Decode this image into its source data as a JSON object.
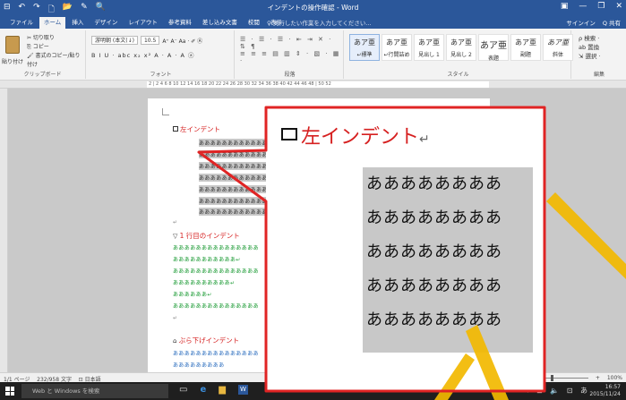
{
  "titlebar": {
    "title": "インデントの操作確認 - Word",
    "qat": [
      "⊟",
      "↶",
      "↷",
      "🗋",
      "📂",
      "✎",
      "🔍"
    ],
    "controls": [
      "▣",
      "—",
      "❐",
      "✕"
    ]
  },
  "ribbon_tabs": {
    "tabs": [
      "ファイル",
      "ホーム",
      "挿入",
      "デザイン",
      "レイアウト",
      "参考資料",
      "差し込み文書",
      "校閲",
      "表示"
    ],
    "tellme": "♀ 実行したい作業を入力してください...",
    "signin": "サインイン",
    "share": "Q 共有"
  },
  "ribbon": {
    "clipboard": {
      "paste": "貼り付け",
      "cut": "✂ 切り取り",
      "copy": "⎘ コピー",
      "format": "🖌 書式のコピー/貼り付け",
      "label": "クリップボード"
    },
    "font": {
      "name": "游明朝 (本文(↓)",
      "size": "10.5",
      "row2": "B I U · abc x₂ x²  A · A · A ⓐ",
      "label": "フォント"
    },
    "paragraph": {
      "row1": "☰ · ☰ · ☰ · ⇤ ⇥ ✕ · ⇅ ¶",
      "row2": "≡ ≡ ≡ ▤ ▥ ⇕ · ▧ · ▦ ·",
      "label": "段落"
    },
    "styles": {
      "items": [
        {
          "sample": "あア亜",
          "name": "↵標準"
        },
        {
          "sample": "あア亜",
          "name": "↵行間詰め"
        },
        {
          "sample": "あア亜",
          "name": "見出し 1"
        },
        {
          "sample": "あア亜",
          "name": "見出し 2"
        },
        {
          "sample": "あア亜",
          "name": "表題"
        },
        {
          "sample": "あア亜",
          "name": "副題"
        },
        {
          "sample": "あア亜",
          "name": "斜体"
        }
      ],
      "label": "スタイル"
    },
    "editing": {
      "find": "ρ 検索 ·",
      "replace": "ab 置換",
      "select": "⇲ 選択 ·",
      "label": "編集"
    }
  },
  "ruler": {
    "ticks": "2 | 2  4  6  8  10  12  14  16  18  20  22  24  26  28  30  32  34  36  38  40  42  44  46  48 | 50  52"
  },
  "document": {
    "heading1": "左インデント",
    "block1": [
      "ああああああああああああ",
      "ああああああああああああ",
      "ああああああああああああ",
      "ああああああああああああ",
      "ああああああああああああ",
      "ああああああああああああ",
      "ああああああああああああ"
    ],
    "heading2": "1 行目のインデント",
    "block2": [
      "あああああああああああああああ",
      "あああああああああああ↵",
      "あああああああああああああああ",
      "ああああああああああ↵",
      "ああああああ↵",
      "あああああああああああああああ"
    ],
    "heading3": "ぶら下げインデント",
    "block3": [
      "あああああああああああああああ",
      "あああああああああ"
    ]
  },
  "magnifier": {
    "heading": "左インデント",
    "return_mark": "↵",
    "lines": [
      "ああああああああ",
      "ああああああああ",
      "ああああああああ",
      "ああああああああ",
      "ああああああああ"
    ]
  },
  "statusbar": {
    "page": "1/1 ページ",
    "words": "232/958 文字",
    "lang": "日本語",
    "zoom": "100%"
  },
  "taskbar": {
    "search": "Web と Windows を検索",
    "time": "16:57",
    "date": "2015/11/24",
    "tray": "へ ⊡ 🔈 ⊡ あ"
  },
  "colors": {
    "word_blue": "#2b579a",
    "heading_red": "#d62020",
    "callout_red": "#e02424",
    "arrow_yellow": "#f2b800"
  }
}
